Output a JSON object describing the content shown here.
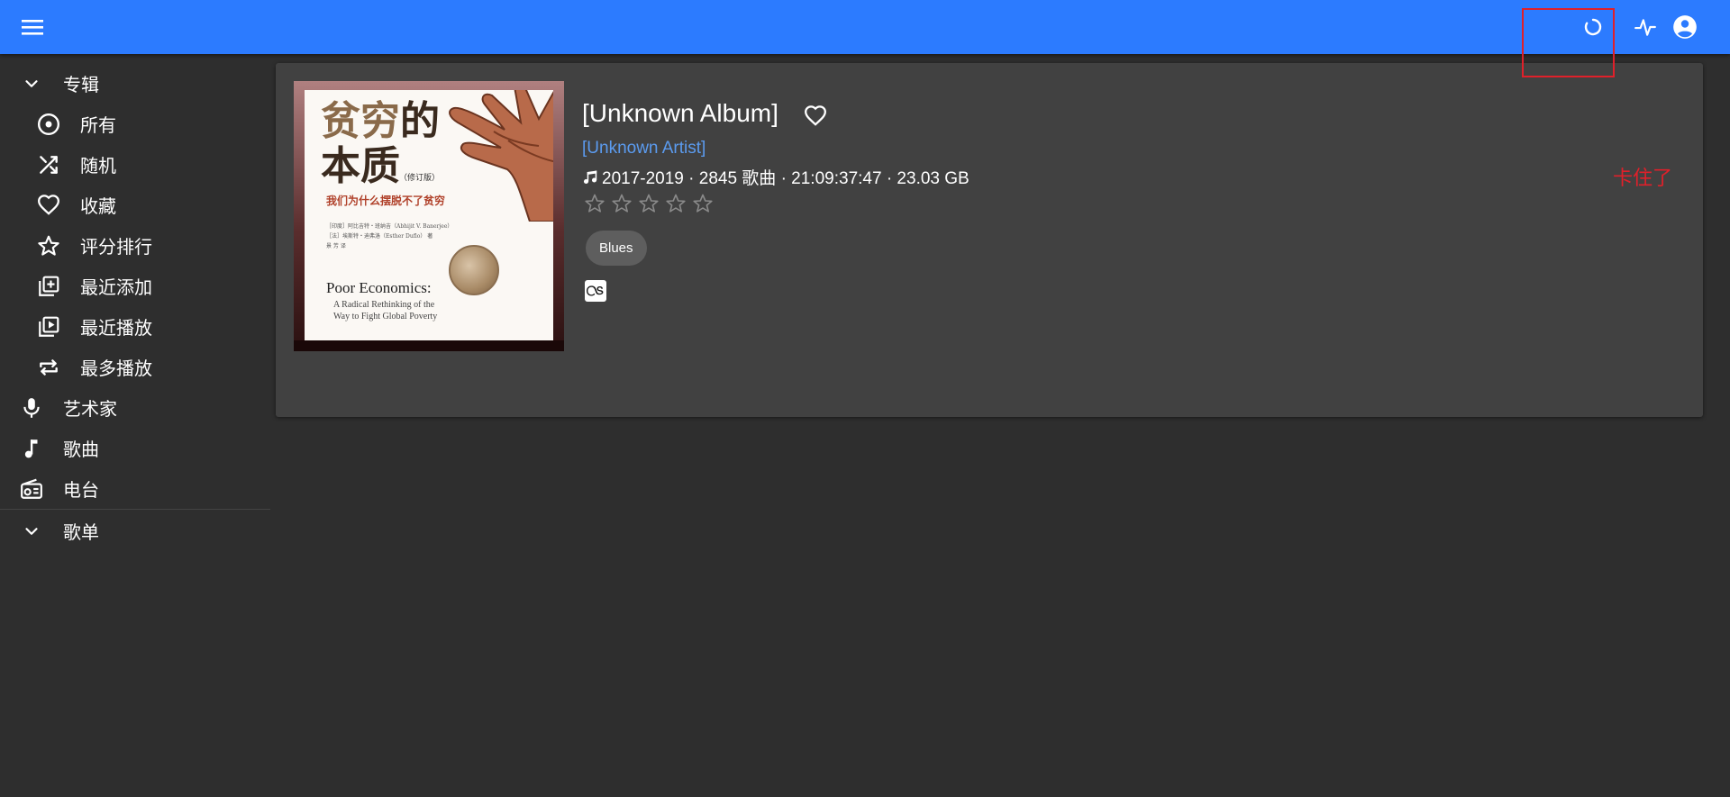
{
  "appbar": {
    "menu_icon": "hamburger-menu-icon",
    "loading_icon": "loading-spinner-icon",
    "activity_icon": "activity-pulse-icon",
    "account_icon": "account-circle-icon",
    "accent_color": "#2c7bff"
  },
  "sidebar": {
    "albums_section": {
      "label": "专辑",
      "icon": "chevron-down-icon"
    },
    "album_items": [
      {
        "label": "所有",
        "icon": "disc-icon"
      },
      {
        "label": "随机",
        "icon": "shuffle-icon"
      },
      {
        "label": "收藏",
        "icon": "heart-icon"
      },
      {
        "label": "评分排行",
        "icon": "star-icon"
      },
      {
        "label": "最近添加",
        "icon": "library-add-icon"
      },
      {
        "label": "最近播放",
        "icon": "library-play-icon"
      },
      {
        "label": "最多播放",
        "icon": "repeat-icon"
      }
    ],
    "main_items": [
      {
        "label": "艺术家",
        "icon": "microphone-icon"
      },
      {
        "label": "歌曲",
        "icon": "music-note-icon"
      },
      {
        "label": "电台",
        "icon": "radio-icon"
      }
    ],
    "playlists_section": {
      "label": "歌单",
      "icon": "chevron-down-icon"
    }
  },
  "album": {
    "title": "[Unknown Album]",
    "artist": "[Unknown Artist]",
    "meta": "2017-2019 · 2845 歌曲 · 21:09:37:47 · 23.03 GB",
    "rating": 0,
    "rating_max": 5,
    "genre": "Blues",
    "lastfm_icon": "lastfm-icon",
    "cover": {
      "title_line1_a": "贫穷",
      "title_line1_b": "的",
      "title_line2": "本质",
      "edition": "（修订版）",
      "subtitle": "我们为什么摆脱不了贫穷",
      "authors_line1": "［印度］阿比吉特・班纳吉（Abhijit V. Banerjee）",
      "authors_line2": "［法］埃斯特・迪弗洛（Esther Duflo）",
      "authors_suffix": "著",
      "translator": "景 芳 译",
      "en_title": "Poor Economics:",
      "en_sub_line1": "A Radical Rethinking of the",
      "en_sub_line2": "Way to Fight Global Poverty"
    }
  },
  "annotation": {
    "text": "卡住了",
    "color": "#e0202a"
  }
}
